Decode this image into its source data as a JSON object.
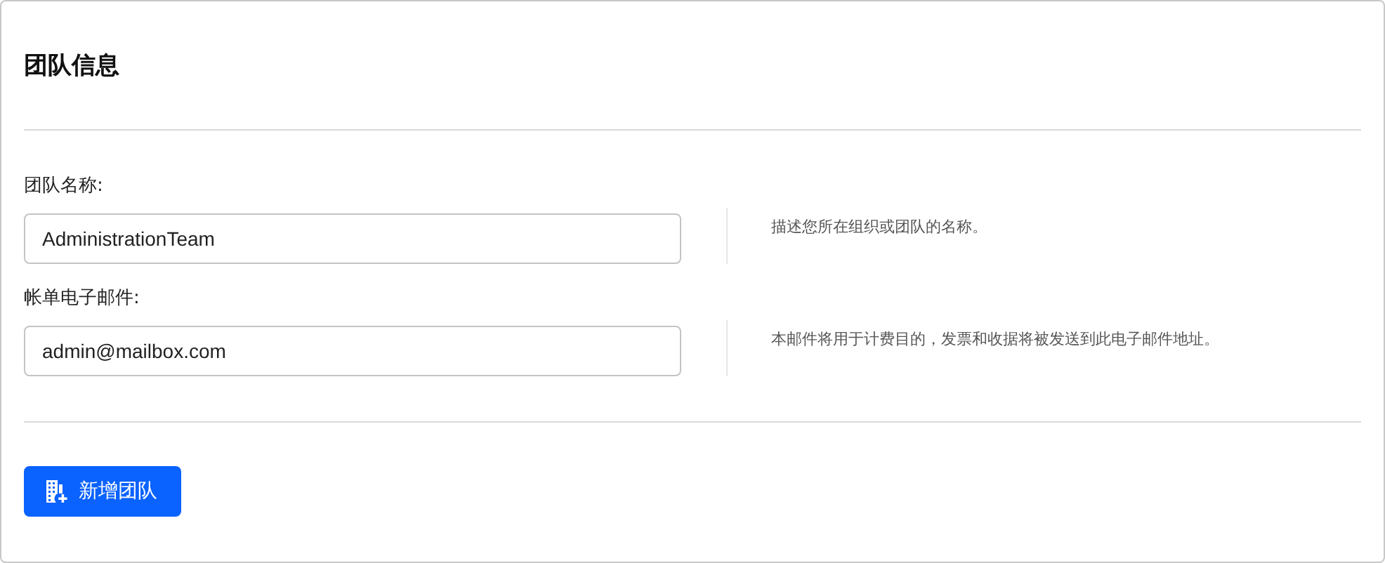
{
  "title": "团队信息",
  "fields": [
    {
      "label": "团队名称:",
      "value": "AdministrationTeam",
      "help": "描述您所在组织或团队的名称。"
    },
    {
      "label": "帐单电子邮件:",
      "value": "admin@mailbox.com",
      "help": "本邮件将用于计费目的，发票和收据将被发送到此电子邮件地址。"
    }
  ],
  "button": {
    "label": "新增团队"
  }
}
